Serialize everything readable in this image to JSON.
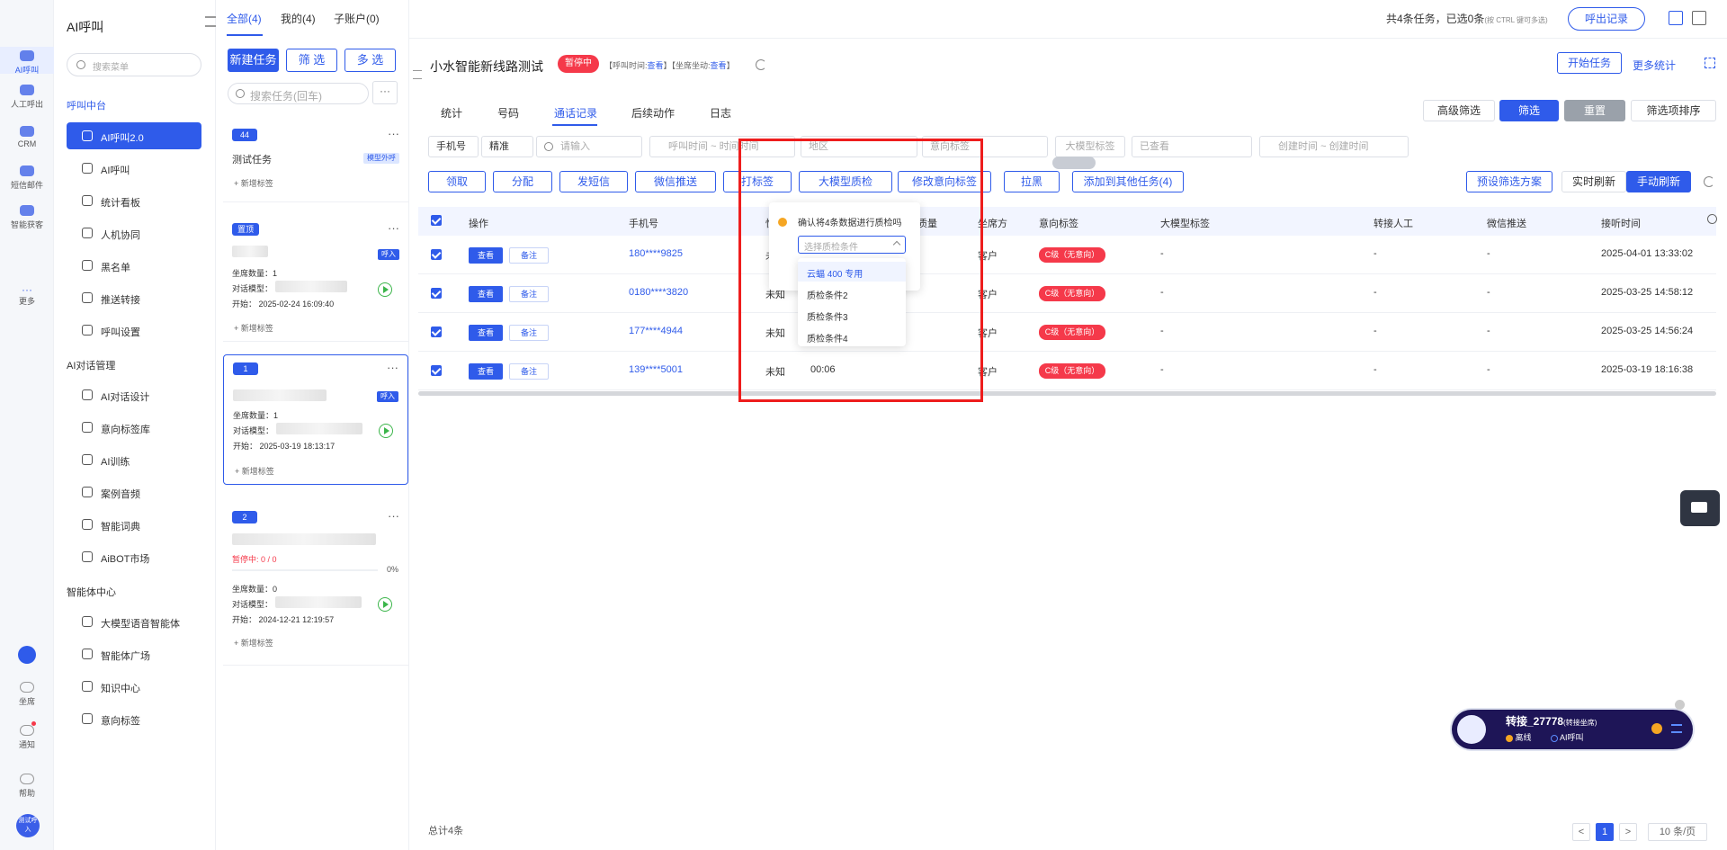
{
  "rail": {
    "items": [
      "AI呼叫",
      "人工呼出",
      "CRM",
      "短信邮件",
      "智能获客",
      "更多"
    ],
    "bottom": [
      "坐席",
      "通知",
      "帮助"
    ],
    "avatar": "测试呼入"
  },
  "nav": {
    "title": "AI呼叫",
    "search_placeholder": "搜索菜单",
    "sections": [
      "呼叫中台",
      "AI对话管理",
      "智能体中心"
    ],
    "group1": [
      "AI呼叫2.0",
      "AI呼叫",
      "统计看板",
      "人机协同",
      "黑名单",
      "推送转接",
      "呼叫设置"
    ],
    "group2": [
      "AI对话设计",
      "意向标签库",
      "AI训练",
      "案例音频",
      "智能词典",
      "AiBOT市场"
    ],
    "group3": [
      "大模型语音智能体",
      "智能体广场",
      "知识中心",
      "意向标签"
    ]
  },
  "tasks": {
    "tabs": [
      "全部(4)",
      "我的(4)",
      "子账户(0)"
    ],
    "buttons": [
      "新建任务",
      "筛 选",
      "多 选"
    ],
    "search_placeholder": "搜索任务(回车)",
    "more": "···",
    "add_tag": "+ 新增标签",
    "labels": {
      "seats": "坐席数量：",
      "model": "对话模型：",
      "start": "开始："
    },
    "cards": [
      {
        "badge": "44",
        "name": "测试任务",
        "tag": "模型外呼"
      },
      {
        "badge": "置顶",
        "tag": "呼入",
        "seats": "1",
        "start": "2025-02-24 16:09:40"
      },
      {
        "badge": "1",
        "tag": "呼入",
        "seats": "1",
        "start": "2025-03-19 18:13:17"
      },
      {
        "badge": "2",
        "status": "暂停中: 0 / 0",
        "percent": "0%",
        "seats": "0",
        "start": "2024-12-21 12:19:57"
      }
    ]
  },
  "header": {
    "summary": "共4条任务，已选0条",
    "hint": "(按 CTRL 键可多选)",
    "export": "呼出记录"
  },
  "task": {
    "title": "小水智能新线路测试",
    "status": "暂停中",
    "meta_prefix1": "【呼叫时间:",
    "meta_link1": "查看",
    "meta_prefix2": "】【坐席坐动:",
    "meta_link2": "查看",
    "meta_end": "】",
    "start_btn": "开始任务",
    "more_stats": "更多统计"
  },
  "subtabs": [
    "统计",
    "号码",
    "通话记录",
    "后续动作",
    "日志"
  ],
  "filter_btns": [
    "高级筛选",
    "筛选",
    "重置",
    "筛选项排序"
  ],
  "filters": {
    "phone_type": "手机号",
    "match": "精准",
    "search_ph": "请输入",
    "call_time_from": "呼叫时间",
    "call_time_to": "时间时间",
    "region": "地区",
    "intent": "意向标签",
    "llm_tag": "大模型标签",
    "viewed": "已查看",
    "create_from": "创建时间",
    "create_to": "创建时间",
    "range_sep": "~"
  },
  "actions": [
    "领取",
    "分配",
    "发短信",
    "微信推送",
    "打标签",
    "大模型质检",
    "修改意向标签",
    "拉黑",
    "添加到其他任务(4)"
  ],
  "right_actions": [
    "预设筛选方案",
    "实时刷新",
    "手动刷新"
  ],
  "table": {
    "headers": [
      "操作",
      "手机号",
      "性",
      "质量",
      "坐席方",
      "意向标签",
      "大模型标签",
      "转接人工",
      "微信推送",
      "接听时间"
    ],
    "view": "查看",
    "note": "备注",
    "rows": [
      {
        "phone": "180****9825",
        "gender": "未",
        "party": "客户",
        "tag": "C级（无意向）",
        "llm": "-",
        "transfer": "-",
        "wechat": "-",
        "time": "2025-04-01 13:33:02"
      },
      {
        "phone": "0180****3820",
        "gender": "未知",
        "party": "客户",
        "tag": "C级（无意向）",
        "llm": "-",
        "transfer": "-",
        "wechat": "-",
        "time": "2025-03-25 14:58:12"
      },
      {
        "phone": "177****4944",
        "gender": "未知",
        "party": "客户",
        "tag": "C级（无意向）",
        "llm": "-",
        "transfer": "-",
        "wechat": "-",
        "time": "2025-03-25 14:56:24"
      },
      {
        "phone": "139****5001",
        "gender": "未知",
        "duration": "00:06",
        "party": "客户",
        "tag": "C级（无意向）",
        "llm": "-",
        "transfer": "-",
        "wechat": "-",
        "time": "2025-03-19 18:16:38"
      }
    ]
  },
  "popover": {
    "text": "确认将4条数据进行质检吗",
    "placeholder": "选择质检条件",
    "options": [
      "云蝠 400 专用",
      "质检条件2",
      "质检条件3",
      "质检条件4"
    ]
  },
  "footer": {
    "total": "总计4条",
    "page": "1",
    "prev": "<",
    "next": ">",
    "per_page": "10 条/页"
  },
  "callbar": {
    "title": "转接_27778",
    "title_suffix": "(转接坐席)",
    "offline": "离线",
    "ai": "AI呼叫"
  },
  "colors": {
    "accent": "#2f5bea",
    "danger": "#f5394a",
    "highlight_box": "#ee1d1d"
  }
}
